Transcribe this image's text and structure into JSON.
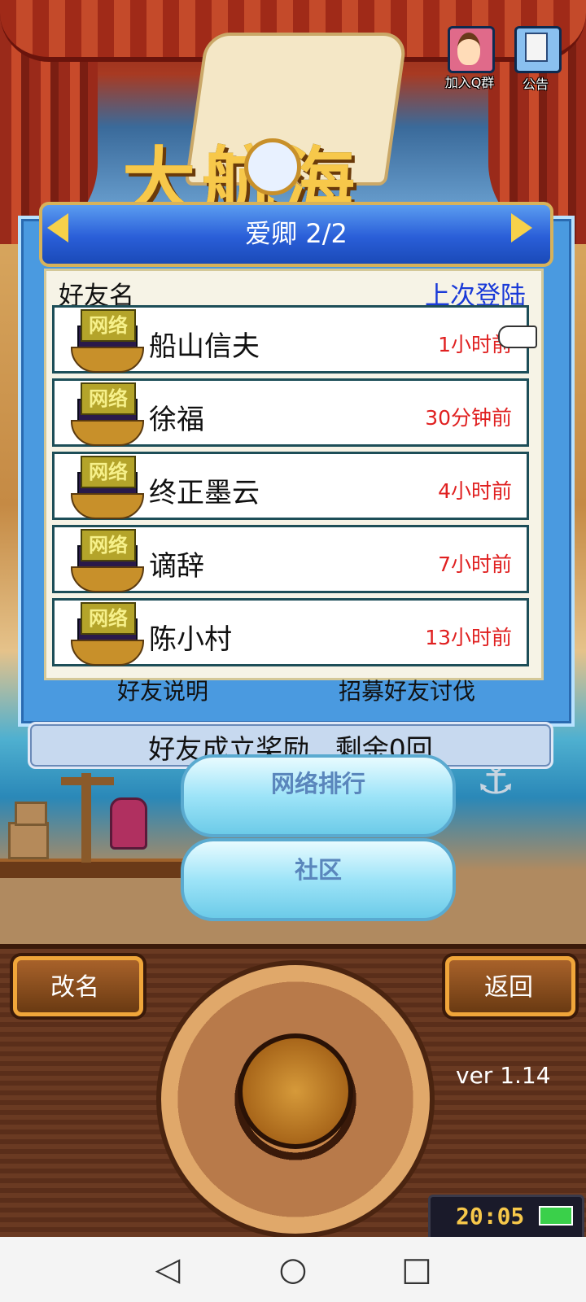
{
  "top_icons": {
    "qq_group_label": "加入Q群",
    "notice_label": "公告"
  },
  "game_logo": "大航海",
  "friend_panel": {
    "title": "爱卿 2/2",
    "header_name": "好友名",
    "header_last_login": "上次登陆",
    "badge_text": "网络",
    "friends": [
      {
        "name": "船山信夫",
        "last_login": "1小时前"
      },
      {
        "name": "徐福",
        "last_login": "30分钟前"
      },
      {
        "name": "终正墨云",
        "last_login": "4小时前"
      },
      {
        "name": "谪辞",
        "last_login": "7小时前"
      },
      {
        "name": "陈小村",
        "last_login": "13小时前"
      }
    ],
    "button_friend_explain": "好友说明",
    "button_recruit": "招募好友讨伐",
    "reward_text": "好友成立奖励   剩余0回"
  },
  "menu": {
    "ranking_label": "网络排行",
    "community_label": "社区"
  },
  "console": {
    "rename_label": "改名",
    "back_label": "返回",
    "version": "ver 1.14",
    "clock": "20:05"
  },
  "colors": {
    "panel_blue": "#4a9ae0",
    "title_gold": "#d7b25a",
    "time_red": "#e02020",
    "login_header_blue": "#1a3ad8"
  }
}
